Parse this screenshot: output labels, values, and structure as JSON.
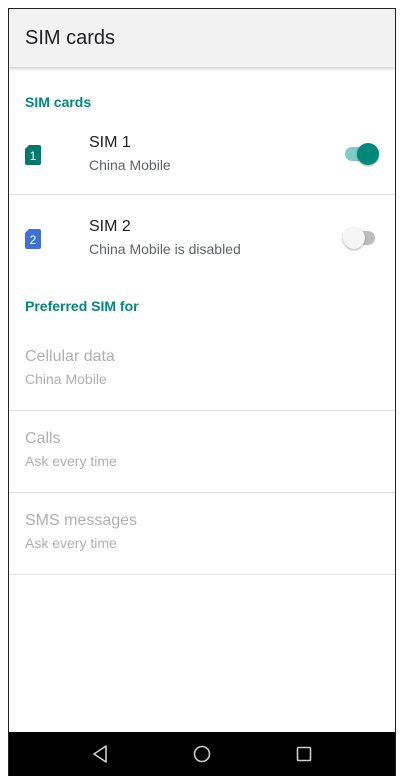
{
  "toolbar": {
    "title": "SIM cards"
  },
  "sections": {
    "sim_cards_header": "SIM cards",
    "preferred_header": "Preferred SIM for"
  },
  "sims": [
    {
      "slot": "1",
      "title": "SIM 1",
      "subtitle": "China Mobile",
      "enabled": true,
      "color": "#00796b",
      "icon": "sim-card-icon"
    },
    {
      "slot": "2",
      "title": "SIM 2",
      "subtitle": "China Mobile is disabled",
      "enabled": false,
      "color": "#3f72d9",
      "icon": "sim-card-icon"
    }
  ],
  "preferences": [
    {
      "title": "Cellular data",
      "subtitle": "China Mobile"
    },
    {
      "title": "Calls",
      "subtitle": "Ask every time"
    },
    {
      "title": "SMS messages",
      "subtitle": "Ask every time"
    }
  ],
  "navbar": {
    "back": "back-icon",
    "home": "home-icon",
    "recents": "recents-icon"
  },
  "colors": {
    "accent": "#00897b",
    "disabled_text": "#b0b0b0"
  }
}
